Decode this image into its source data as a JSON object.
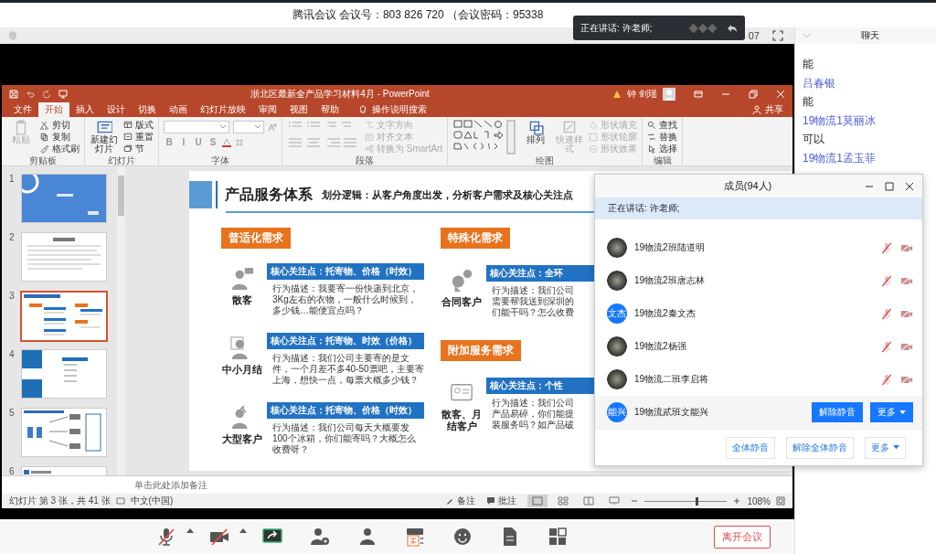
{
  "meeting": {
    "title": "腾讯会议 会议号：803 826 720 （会议密码：95338",
    "timer": "07"
  },
  "speaking_toast": {
    "text": "正在讲话: 许老师;"
  },
  "powerpoint": {
    "title": "浙北区最新全产品学习材料4月 - PowerPoint",
    "user": "钟 剑瑶",
    "tabs": [
      {
        "label": "文件",
        "selected": false
      },
      {
        "label": "开始",
        "selected": true
      },
      {
        "label": "插入",
        "selected": false
      },
      {
        "label": "设计",
        "selected": false
      },
      {
        "label": "切换",
        "selected": false
      },
      {
        "label": "动画",
        "selected": false
      },
      {
        "label": "幻灯片放映",
        "selected": false
      },
      {
        "label": "审阅",
        "selected": false
      },
      {
        "label": "视图",
        "selected": false
      },
      {
        "label": "帮助",
        "selected": false
      }
    ],
    "search": "操作说明搜索",
    "share": "共享",
    "ribbon": [
      {
        "label": "剪贴板",
        "large": [
          {
            "kind": "paste",
            "label": "粘贴",
            "disabled": true
          }
        ],
        "small": [
          {
            "kind": "cut",
            "label": "剪切",
            "disabled": false
          },
          {
            "kind": "copy",
            "label": "复制",
            "disabled": false
          },
          {
            "kind": "brush",
            "label": "格式刷",
            "disabled": false
          }
        ]
      },
      {
        "label": "幻灯片",
        "large": [
          {
            "kind": "slide",
            "label": "新建幻灯片",
            "disabled": false
          }
        ],
        "small": [
          {
            "kind": "layout",
            "label": "版式",
            "disabled": false
          },
          {
            "kind": "reset",
            "label": "重置",
            "disabled": false
          },
          {
            "kind": "section",
            "label": "节",
            "disabled": false
          }
        ]
      },
      {
        "label": "字体",
        "kind": "font",
        "format_buttons": [
          "B",
          "I",
          "U",
          "S"
        ]
      },
      {
        "label": "段落",
        "kind": "paragraph",
        "small": [
          {
            "kind": "direction",
            "label": "文字方向",
            "disabled": true
          },
          {
            "kind": "align",
            "label": "对齐文本",
            "disabled": true
          },
          {
            "kind": "smartart",
            "label": "转换为 SmartArt",
            "disabled": true
          }
        ]
      },
      {
        "label": "绘图",
        "kind": "shapes",
        "large": [
          {
            "kind": "arrange",
            "label": "排列",
            "disabled": false
          },
          {
            "kind": "style",
            "label": "快速样式",
            "disabled": true
          }
        ],
        "small": [
          {
            "kind": "fill",
            "label": "形状填充",
            "disabled": true
          },
          {
            "kind": "outline",
            "label": "形状轮廓",
            "disabled": true
          },
          {
            "kind": "effect",
            "label": "形状效果",
            "disabled": true
          }
        ]
      },
      {
        "label": "编辑",
        "small": [
          {
            "kind": "find",
            "label": "查找",
            "disabled": false
          },
          {
            "kind": "replace",
            "label": "替换",
            "disabled": false
          },
          {
            "kind": "select",
            "label": "选择",
            "disabled": false
          }
        ]
      }
    ],
    "thumbnails": [
      {
        "number": "1",
        "kind": "cover",
        "selected": false
      },
      {
        "number": "2",
        "kind": "text",
        "selected": false
      },
      {
        "number": "3",
        "kind": "layout",
        "selected": true
      },
      {
        "number": "4",
        "kind": "contents",
        "selected": false
      },
      {
        "number": "5",
        "kind": "diagram",
        "selected": false
      },
      {
        "number": "6",
        "kind": "list",
        "selected": false
      }
    ],
    "slide": {
      "title": "产品服务体系",
      "subtitle": "划分逻辑：从客户角度出发，分析客户需求及核心关注点",
      "left": {
        "heading": "普适化需求",
        "items": [
          {
            "kind": "chat",
            "customer": "散客",
            "focus": "核心关注点：托寄物、价格（时效）",
            "desc": "行为描述：我要寄一份快递到北京，3Kg左右的衣物，一般什么时候到，多少钱…能便宜点吗？"
          },
          {
            "kind": "document",
            "customer": "中小月结",
            "focus": "核心关注点：托寄物、时效（价格）",
            "desc": "行为描述：我们公司主要寄的是文件，一个月差不多40-50票吧，主要寄上海，想快一点，每票大概多少钱？"
          },
          {
            "kind": "worker",
            "customer": "大型客户",
            "focus": "核心关注点：托寄物、价格（时效）",
            "desc": "行为描述：我们公司每天大概要发100个冰箱，你们能寄吗？大概怎么收费呀？"
          }
        ]
      },
      "right": [
        {
          "heading": "特殊化需求",
          "items": [
            {
              "kind": "thinker",
              "customer": "合同客户",
              "focus": "核心关注点：全环",
              "desc_lines": [
                "行为描述：我们公司",
                "需要帮我送到深圳的",
                "们能干吗？怎么收费"
              ]
            }
          ]
        },
        {
          "heading": "附加服务需求",
          "items": [
            {
              "kind": "card",
              "customer": "散客、月结客户",
              "focus": "核心关注点：个性",
              "desc_lines": [
                "行为描述：我们公司",
                "产品易碎，你们能提",
                "装服务吗？如产品破"
              ]
            }
          ]
        }
      ]
    },
    "notes": "单击此处添加备注",
    "status": {
      "slide_info": "幻灯片 第 3 张，共 41 张",
      "language": "中文(中国)",
      "notes": "备注",
      "comments": "批注",
      "zoom": "108%",
      "zoom_slider": {
        "level": 0.62
      }
    }
  },
  "members_panel": {
    "title": "成员(94人)",
    "speaking": "正在讲话: 许老师;",
    "members": [
      {
        "name": "19物流2班陆道明",
        "kind": "photo",
        "selected": false,
        "mic_muted": true,
        "video_off": true
      },
      {
        "name": "19物流2班唐志林",
        "kind": "photo",
        "selected": false,
        "mic_muted": true,
        "video_off": true
      },
      {
        "name": "19物流2秦文杰",
        "kind": "initials",
        "initials": "文杰",
        "selected": false,
        "mic_muted": true,
        "video_off": true
      },
      {
        "name": "19物流2杨强",
        "kind": "photo",
        "selected": false,
        "mic_muted": true,
        "video_off": true
      },
      {
        "name": "19物流二班李启将",
        "kind": "photo",
        "selected": false,
        "mic_muted": true,
        "video_off": true
      },
      {
        "name": "19物流貳班文能兴",
        "kind": "initials",
        "initials": "能兴",
        "selected": true
      }
    ],
    "row_buttons": [
      {
        "label": "解除静音",
        "menu": false
      },
      {
        "label": "更多",
        "menu": true
      }
    ],
    "footer_buttons": [
      {
        "label": "全体静音",
        "menu": false
      },
      {
        "label": "解除全体静音",
        "menu": false
      },
      {
        "label": "更多",
        "menu": true
      }
    ]
  },
  "chat": {
    "title": "聊天",
    "messages": [
      {
        "kind": "text",
        "text": "能"
      },
      {
        "kind": "sender",
        "text": "吕春银"
      },
      {
        "kind": "text",
        "text": "能"
      },
      {
        "kind": "sender",
        "text": "19物流1莫丽冰"
      },
      {
        "kind": "text",
        "text": "可以"
      },
      {
        "kind": "sender",
        "text": "19物流1孟玉菲"
      }
    ]
  },
  "toolbar": {
    "buttons": [
      {
        "kind": "mic",
        "muted": true,
        "menu": true
      },
      {
        "kind": "camera",
        "muted": true,
        "menu": true
      },
      {
        "kind": "share",
        "muted": false,
        "menu": false
      },
      {
        "kind": "invite",
        "muted": false,
        "menu": false
      },
      {
        "kind": "members",
        "muted": false,
        "menu": false
      },
      {
        "kind": "whiteboard",
        "muted": false,
        "menu": false
      },
      {
        "kind": "emoji",
        "muted": false,
        "menu": false
      },
      {
        "kind": "document",
        "muted": false,
        "menu": false
      },
      {
        "kind": "settings",
        "muted": false,
        "menu": false
      }
    ],
    "leave": "离开会议"
  }
}
